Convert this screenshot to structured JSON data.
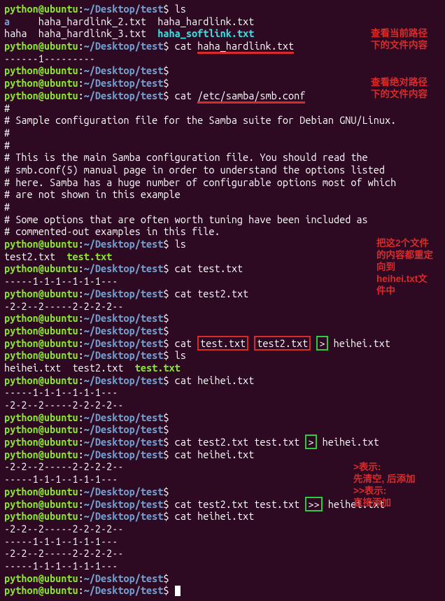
{
  "prompt": {
    "user": "python@ubuntu",
    "colon": ":",
    "path": "~/Desktop/test",
    "dollar": "$"
  },
  "lines": {
    "l0_cmd": " ls",
    "l1_a": "a",
    "l1_b": "     haha_hardlink_2.txt  haha_hardlink.txt",
    "l2_a": "haha",
    "l2_b": "  haha_hardlink_3.txt  ",
    "l2_soft": "haha_softlink.txt",
    "l3_cmd": " cat ",
    "l3_arg": "haha_hardlink.txt",
    "l4": "------1---------",
    "l7_cmd": " cat ",
    "l7_arg": "/etc/samba/smb.conf",
    "l8": "#",
    "l9": "# Sample configuration file for the Samba suite for Debian GNU/Linux.",
    "l10": "#",
    "l11": "#",
    "l12": "# This is the main Samba configuration file. You should read the",
    "l13": "# smb.conf(5) manual page in order to understand the options listed",
    "l14": "# here. Samba has a huge number of configurable options most of which",
    "l15": "# are not shown in this example",
    "l16": "#",
    "l17": "# Some options that are often worth tuning have been included as",
    "l18": "# commented-out examples in this file.",
    "l19_cmd": " ls",
    "l20_a": "test2.txt  ",
    "l20_b": "test.txt",
    "l21_cmd": " cat test.txt",
    "l22": "-----1-1-1--1-1-1---",
    "l23_cmd": " cat test2.txt",
    "l24": "-2-2--2-----2-2-2-2--",
    "l27_cmd": " cat ",
    "l27_a": "test.txt",
    "l27_sp1": " ",
    "l27_b": "test2.txt",
    "l27_sp2": " ",
    "l27_c": ">",
    "l27_sp3": " heihei.txt",
    "l28_cmd": " ls",
    "l29_a": "heihei.txt  test2.txt  ",
    "l29_b": "test.txt",
    "l30_cmd": " cat heihei.txt",
    "l31": "-----1-1-1--1-1-1---",
    "l32": "-2-2--2-----2-2-2-2--",
    "l35_cmd": " cat test2.txt test.txt ",
    "l35_gt": ">",
    "l35_after": " heihei.txt",
    "l36_cmd": " cat heihei.txt",
    "l37": "-2-2--2-----2-2-2-2--",
    "l38": "-----1-1-1--1-1-1---",
    "l40_cmd": " cat test2.txt test.txt ",
    "l40_gt": ">>",
    "l40_after": " heihei.txt",
    "l41_cmd": " cat heihei.txt",
    "l42": "-2-2--2-----2-2-2-2--",
    "l43": "-----1-1-1--1-1-1---",
    "l44": "-2-2--2-----2-2-2-2--",
    "l45": "-----1-1-1--1-1-1---"
  },
  "anno": {
    "a1_l1": "查看当前路径",
    "a1_l2": "下的文件内容",
    "a2_l1": "查看绝对路径",
    "a2_l2": "下的文件内容",
    "a3_l1": "把这2个文件",
    "a3_l2": "的内容都重定",
    "a3_l3": "向到",
    "a3_l4": "heihei.txt文",
    "a3_l5": "件中",
    "a4_l1": ">表示:",
    "a4_l2": "先清空, 后添加",
    "a4_l3": ">>表示:",
    "a4_l4": "直接添加"
  }
}
